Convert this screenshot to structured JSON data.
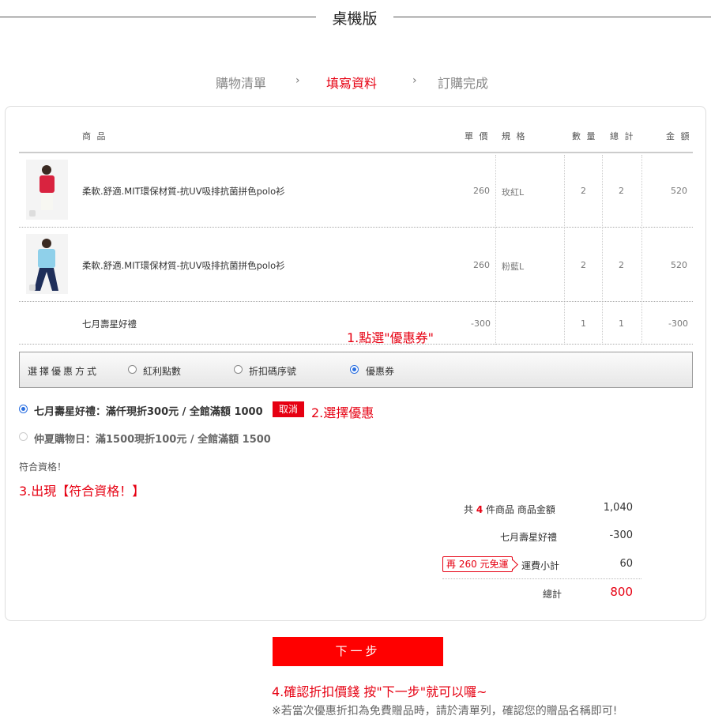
{
  "page_title": "桌機版",
  "steps": [
    {
      "label": "購物清單"
    },
    {
      "label": "填寫資料"
    },
    {
      "label": "訂購完成"
    }
  ],
  "step_arrow": "›",
  "table": {
    "headers": {
      "product": "商 品",
      "unit_price": "單 價",
      "spec": "規 格",
      "qty": "數 量",
      "subtotal": "總 計",
      "amount": "金 額"
    },
    "rows": [
      {
        "name": "柔軟.舒適.MIT環保材質-抗UV吸排抗菌拼色polo衫",
        "price": "260",
        "spec": "玫紅L",
        "qty": "2",
        "total": "2",
        "amount": "520",
        "shirt_color": "#d9233f"
      },
      {
        "name": "柔軟.舒適.MIT環保材質-抗UV吸排抗菌拼色polo衫",
        "price": "260",
        "spec": "粉藍L",
        "qty": "2",
        "total": "2",
        "amount": "520",
        "shirt_color": "#8fd0ea"
      },
      {
        "name": "七月壽星好禮",
        "price": "-300",
        "spec": "",
        "qty": "1",
        "total": "1",
        "amount": "-300"
      }
    ]
  },
  "annotations": {
    "step1": "1.點選\"優惠券\"",
    "step2": "2.選擇優惠",
    "step3": "3.出現【符合資格！】",
    "step4": "4.確認折扣價錢 按\"下一步\"就可以囉~"
  },
  "discount_bar": {
    "label": "選擇優惠方式",
    "options": [
      {
        "label": "紅利點數",
        "selected": false
      },
      {
        "label": "折扣碼序號",
        "selected": false
      },
      {
        "label": "優惠券",
        "selected": true
      }
    ]
  },
  "coupons": [
    {
      "label": "七月壽星好禮：滿仟現折300元 / 全館滿額 1000",
      "selected": true
    },
    {
      "label": "仲夏購物日：滿1500現折100元 / 全館滿額 1500",
      "selected": false
    }
  ],
  "cancel_label": "取消",
  "eligibility": "符合資格！",
  "summary": {
    "count_prefix": "共",
    "count": "4",
    "count_suffix": "件商品 商品金額",
    "goods_amount": "1,040",
    "coupon_label": "七月壽星好禮",
    "coupon_amount": "-300",
    "shipping_badge": "再 260 元免運",
    "shipping_label": "運費小計",
    "shipping_amount": "60",
    "total_label": "總計",
    "total_amount": "800"
  },
  "next_button": "下一步",
  "footnote": "※若當次優惠折扣為免費贈品時，請於清單列，確認您的贈品名稱即可!",
  "colors": {
    "accent": "#e60012",
    "button": "#ff0000",
    "radio": "#2a6fe0"
  }
}
